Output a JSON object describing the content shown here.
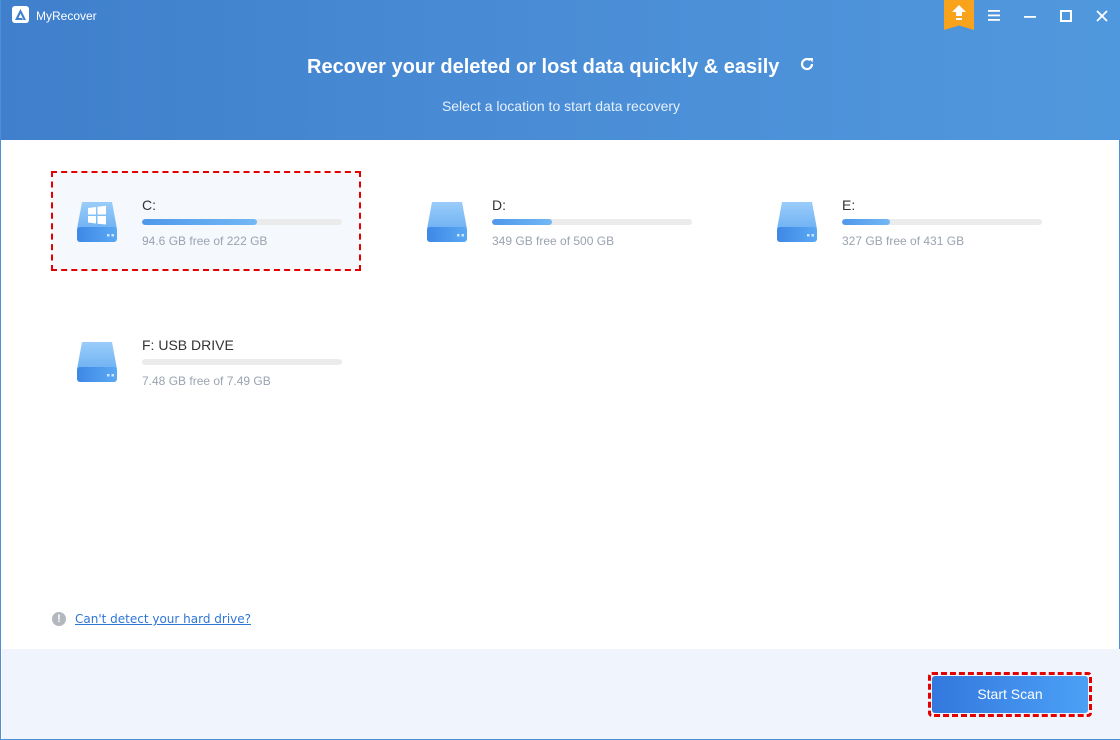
{
  "app": {
    "title": "MyRecover",
    "upgrade_icon": "upgrade-arrow-icon",
    "window_controls": [
      "menu-icon",
      "minimize-icon",
      "maximize-icon",
      "close-icon"
    ]
  },
  "header": {
    "headline": "Recover your deleted or lost data quickly & easily",
    "refresh_icon": "refresh-icon",
    "subline": "Select a location to start data recovery"
  },
  "drives": [
    {
      "name": "C:",
      "info": "94.6 GB free of 222 GB",
      "used_fraction": 0.574,
      "free_gb": 94.6,
      "total_gb": 222,
      "system": true,
      "selected": true
    },
    {
      "name": "D:",
      "info": "349 GB free of 500 GB",
      "used_fraction": 0.302,
      "free_gb": 349,
      "total_gb": 500,
      "system": false,
      "selected": false
    },
    {
      "name": "E:",
      "info": "327 GB free of 431 GB",
      "used_fraction": 0.241,
      "free_gb": 327,
      "total_gb": 431,
      "system": false,
      "selected": false
    },
    {
      "name": "F: USB DRIVE",
      "info": "7.48 GB free of 7.49 GB",
      "used_fraction": 0.001,
      "free_gb": 7.48,
      "total_gb": 7.49,
      "system": false,
      "selected": false
    }
  ],
  "help": {
    "icon": "!",
    "link_text": "Can't detect your hard drive? "
  },
  "footer": {
    "start_scan_label": "Start Scan"
  },
  "colors": {
    "header": "#4a8dd6",
    "accent": "#2e76d6",
    "upgrade": "#f9a21b",
    "selection_border": "#e50000"
  }
}
